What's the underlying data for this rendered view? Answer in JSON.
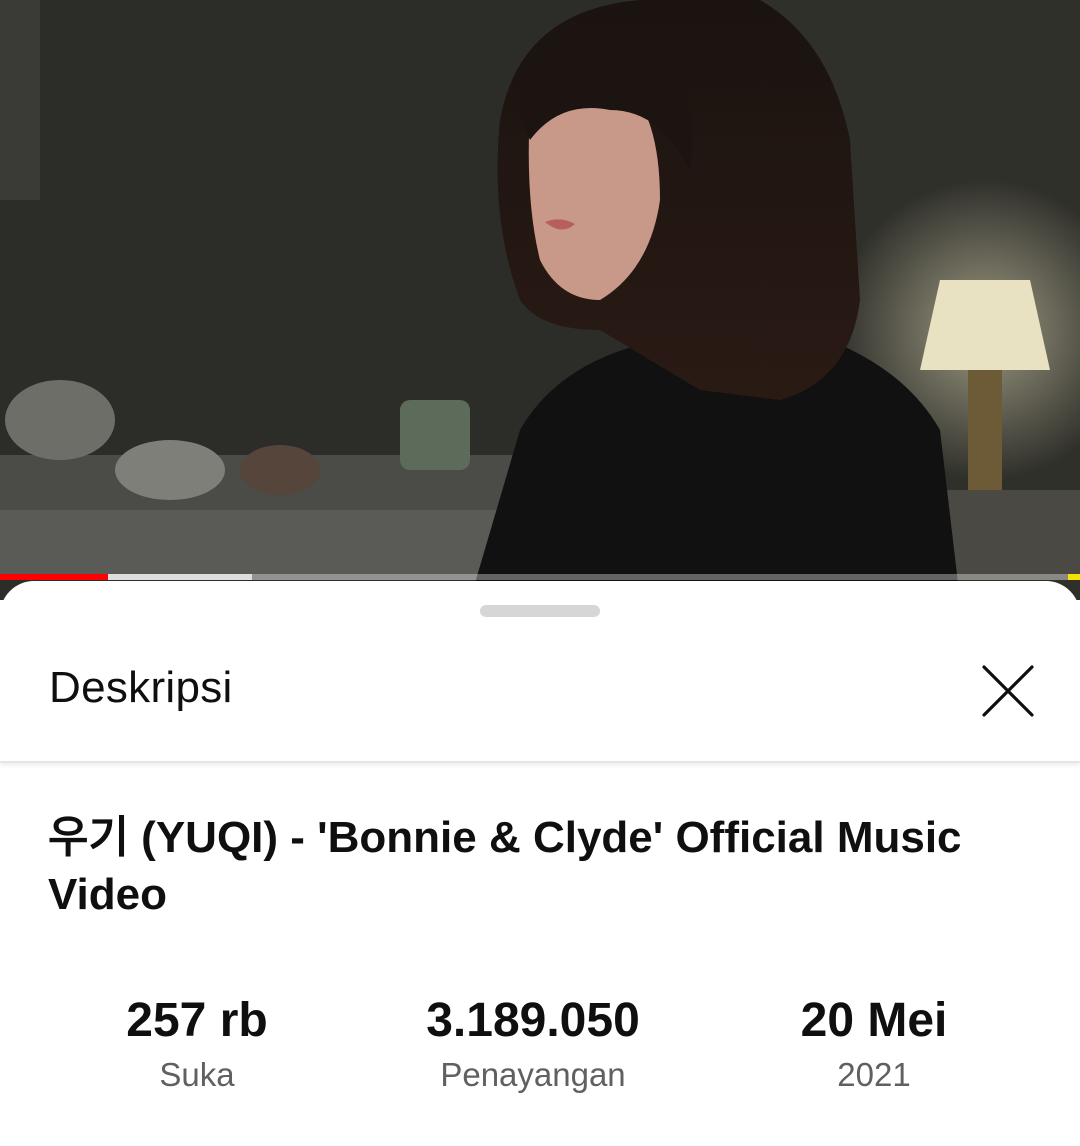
{
  "video": {
    "progress_played": 0.1,
    "progress_buffered": 0.233
  },
  "description_sheet": {
    "title": "Deskripsi",
    "close_icon": "close-icon",
    "video_title": "우기 (YUQI) - 'Bonnie & Clyde' Official Music Video",
    "stats": [
      {
        "value": "257 rb",
        "label": "Suka"
      },
      {
        "value": "3.189.050",
        "label": "Penayangan"
      },
      {
        "value": "20 Mei",
        "label": "2021"
      }
    ]
  },
  "colors": {
    "accent": "#ff0000",
    "text_primary": "#0f0f0f",
    "text_secondary": "#606060"
  }
}
